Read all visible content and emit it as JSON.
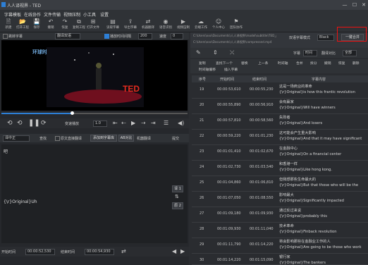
{
  "window": {
    "title": "人人译视界 - TED"
  },
  "menu": [
    "字幕模板",
    "在线协作",
    "文件传输",
    "视频压制",
    "小工具",
    "设置"
  ],
  "toolbar": [
    {
      "icon": "file-icon",
      "label": "新建"
    },
    {
      "icon": "folder-icon",
      "label": "打开工程"
    },
    {
      "icon": "save-icon",
      "label": "保存"
    },
    {
      "icon": "undo-icon",
      "label": "撤销"
    },
    {
      "icon": "redo-icon",
      "label": "恢复"
    },
    {
      "icon": "copy-icon",
      "label": "复制工程"
    },
    {
      "icon": "insert-icon",
      "label": "打开文件"
    },
    {
      "icon": "subtitle-icon",
      "label": "读取字幕"
    },
    {
      "icon": "export-icon",
      "label": "导出字幕"
    },
    {
      "icon": "translate-icon",
      "label": "机器翻译"
    },
    {
      "icon": "ai-icon",
      "label": "语音识别"
    },
    {
      "icon": "video-icon",
      "label": "视频压制"
    },
    {
      "icon": "cloud-icon",
      "label": "云端工作"
    },
    {
      "icon": "person-icon",
      "label": "个人中心"
    },
    {
      "icon": "collab-icon",
      "label": "团队协作"
    }
  ],
  "options": {
    "snap_label": "跳转字幕",
    "mode_value": "翻译双语",
    "rate_label": "播放时间间隔",
    "rate_value": "200",
    "volume_label": "速度",
    "volume_value": "0"
  },
  "video": {
    "logo": "TED",
    "brand": "环球时"
  },
  "controls": {
    "speed_label": "变速播放",
    "speed_value": "1.0"
  },
  "row2": {
    "mode_value": "译中正",
    "items": [
      "查找",
      "原文直接翻译",
      "添加到字幕库",
      "AB对比",
      "机器翻译",
      "提交"
    ]
  },
  "editor": {
    "line1": "吧",
    "line2": "{\\r}Original}Uh",
    "btn_up": "译 1",
    "btn_down": "原 2"
  },
  "status": {
    "start_label": "开始时间",
    "start_value": "00:00:52,530",
    "end_label": "结束时间",
    "end_value": "00:00:54,930"
  },
  "path": {
    "line1": "C:\\Users\\xxx\\Documents\\人人译视界\\model\\subtitle\\TED_part_1_1.srt",
    "line2": "C:\\Users\\xxx\\Documents\\人人译视界\\compressed.mp4",
    "lang_label": "双语字幕模式",
    "lang_value": "Black",
    "action_button": "一键合并"
  },
  "rtools": {
    "label1": "字幕",
    "label2": "时间",
    "label3": "翻译对比",
    "label4": "全部",
    "items": [
      "复制",
      "查找下一个",
      "替换",
      "上一条",
      "时间轴",
      "合并",
      "拆分",
      "撤销",
      "恢复",
      "删除",
      "时间轴偏移",
      "插入字幕"
    ]
  },
  "table": {
    "headers": [
      "序号",
      "开始时间",
      "结束时间",
      "字幕内容"
    ],
    "rows": [
      {
        "idx": "19",
        "start": "00:00:53,610",
        "end": "00:00:55,230",
        "t1": "这是一场商业的革命",
        "t2": "{\\r}Original}is how this frantic revolution"
      },
      {
        "idx": "20",
        "start": "00:00:55,890",
        "end": "00:00:56,910",
        "t1": "会有赢家",
        "t2": "{\\r}Original}Will have winners"
      },
      {
        "idx": "21",
        "start": "00:00:57,810",
        "end": "00:00:58,560",
        "t1": "失败者",
        "t2": "{\\r}Original}And losers"
      },
      {
        "idx": "22",
        "start": "00:00:59,220",
        "end": "00:01:01,230",
        "t1": "这可能会产生重大影响",
        "t2": "{\\r}Original}And that it may have significant"
      },
      {
        "idx": "23",
        "start": "00:01:01,410",
        "end": "00:01:02,670",
        "t1": "在金融中心",
        "t2": "{\\r}Original}On a financial center"
      },
      {
        "idx": "24",
        "start": "00:01:02,730",
        "end": "00:01:03,540",
        "t1": "和香港一样",
        "t2": "{\\r}Original}Like hong kong."
      },
      {
        "idx": "25",
        "start": "00:01:04,860",
        "end": "00:01:06,810",
        "t1": "但我想那些生命最大的",
        "t2": "{\\r}Original}But that those who will be the"
      },
      {
        "idx": "26",
        "start": "00:01:07,050",
        "end": "00:01:08,550",
        "t1": "影响最大",
        "t2": "{\\r}Original}Significantly impacted"
      },
      {
        "idx": "27",
        "start": "00:01:09,180",
        "end": "00:01:09,930",
        "t1": "通过反过来说",
        "t2": "{\\r}Original}probably this"
      },
      {
        "idx": "28",
        "start": "00:01:09,930",
        "end": "00:01:11,040",
        "t1": "技术革命",
        "t2": "{\\r}Original}Finback revolution"
      },
      {
        "idx": "29",
        "start": "00:01:11,790",
        "end": "00:01:14,220",
        "t1": "将会影响那些在金融业工作的人",
        "t2": "{\\r}Original}Are going to be those who work"
      },
      {
        "idx": "30",
        "start": "00:01:14,220",
        "end": "00:01:15,090",
        "t1": "银行家",
        "t2": "{\\r}Original}The bankers"
      },
      {
        "idx": "31",
        "start": "00:01:16,500",
        "end": "00:01:17,340",
        "t1": "未来",
        "t2": "{\\r}Original}Of the future"
      }
    ]
  }
}
